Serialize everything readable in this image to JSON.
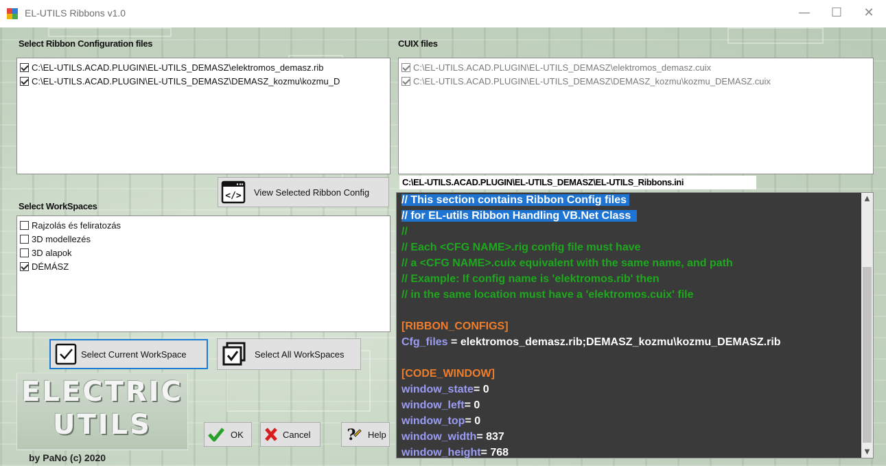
{
  "window": {
    "title": "EL-UTILS Ribbons v1.0",
    "controls": {
      "minimize": "—",
      "maximize": "☐",
      "close": "✕"
    }
  },
  "ribbon_files": {
    "label": "Select Ribbon Configuration files",
    "items": [
      {
        "checked": true,
        "text": "C:\\EL-UTILS.ACAD.PLUGIN\\EL-UTILS_DEMASZ\\elektromos_demasz.rib"
      },
      {
        "checked": true,
        "text": "C:\\EL-UTILS.ACAD.PLUGIN\\EL-UTILS_DEMASZ\\DEMASZ_kozmu\\kozmu_D"
      }
    ]
  },
  "cuix_files": {
    "label": "CUIX files",
    "items": [
      {
        "checked": true,
        "text": "C:\\EL-UTILS.ACAD.PLUGIN\\EL-UTILS_DEMASZ\\elektromos_demasz.cuix"
      },
      {
        "checked": true,
        "text": "C:\\EL-UTILS.ACAD.PLUGIN\\EL-UTILS_DEMASZ\\DEMASZ_kozmu\\kozmu_DEMASZ.cuix"
      }
    ]
  },
  "view_config_button": {
    "label": "View Selected Ribbon Config"
  },
  "workspaces": {
    "label": "Select WorkSpaces",
    "items": [
      {
        "checked": false,
        "text": "Rajzolás és feliratozás"
      },
      {
        "checked": false,
        "text": "3D modellezés"
      },
      {
        "checked": false,
        "text": "3D alapok"
      },
      {
        "checked": true,
        "text": "DÉMÁSZ"
      }
    ]
  },
  "workspace_buttons": {
    "current": "Select Current WorkSpace",
    "all": "Select All WorkSpaces"
  },
  "ini_path": "C:\\EL-UTILS.ACAD.PLUGIN\\EL-UTILS_DEMASZ\\EL-UTILS_Ribbons.ini",
  "ini_lines": [
    {
      "type": "selected",
      "text": "// This section contains Ribbon Config files "
    },
    {
      "type": "selected",
      "text": "// for EL-utils Ribbon Handling VB.Net Class  "
    },
    {
      "type": "comment",
      "text": "//"
    },
    {
      "type": "comment",
      "text": "// Each <CFG NAME>.rig config file must have"
    },
    {
      "type": "comment",
      "text": "// a <CFG NAME>.cuix equivalent with the same name, and path"
    },
    {
      "type": "comment",
      "text": "// Example: If config name is 'elektromos.rib' then"
    },
    {
      "type": "comment",
      "text": "// in the same location must have a 'elektromos.cuix' file"
    },
    {
      "type": "blank",
      "text": ""
    },
    {
      "type": "section",
      "text": "[RIBBON_CONFIGS]"
    },
    {
      "type": "kv",
      "key": "Cfg_files",
      "sep": " = ",
      "value": "elektromos_demasz.rib;DEMASZ_kozmu\\kozmu_DEMASZ.rib"
    },
    {
      "type": "blank",
      "text": ""
    },
    {
      "type": "section",
      "text": "[CODE_WINDOW]"
    },
    {
      "type": "kv",
      "key": "window_state",
      "sep": "= ",
      "value": "0"
    },
    {
      "type": "kv",
      "key": "window_left",
      "sep": "= ",
      "value": "0"
    },
    {
      "type": "kv",
      "key": "window_top",
      "sep": "= ",
      "value": "0"
    },
    {
      "type": "kv",
      "key": "window_width",
      "sep": "= ",
      "value": "837"
    },
    {
      "type": "kv",
      "key": "window_height",
      "sep": "= ",
      "value": "768"
    }
  ],
  "logo": {
    "line1": "ELECTRIC",
    "line2": "UTILS"
  },
  "credit": "by PaNo (c) 2020",
  "dialog_buttons": {
    "ok": "OK",
    "cancel": "Cancel",
    "help": "Help"
  },
  "colors": {
    "comment": "#1ea81e",
    "selection": "#1e74d2",
    "section": "#f07d2a",
    "key": "#9a9cf4",
    "editor_bg": "#3a3a3a"
  }
}
